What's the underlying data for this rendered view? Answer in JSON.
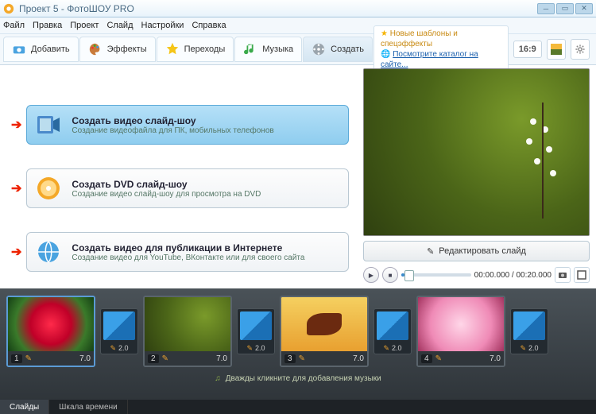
{
  "window": {
    "title": "Проект 5 - ФотоШОУ PRO"
  },
  "menu": {
    "file": "Файл",
    "edit": "Правка",
    "project": "Проект",
    "slide": "Слайд",
    "settings": "Настройки",
    "help": "Справка"
  },
  "tabs": {
    "add": "Добавить",
    "effects": "Эффекты",
    "transitions": "Переходы",
    "music": "Музыка",
    "create": "Создать"
  },
  "promo": {
    "line1": "Новые шаблоны и спецэффекты",
    "line2": "Посмотрите каталог на сайте..."
  },
  "aspect": "16:9",
  "actions": {
    "video": {
      "title": "Создать видео слайд-шоу",
      "subtitle": "Создание видеофайла для ПК, мобильных телефонов"
    },
    "dvd": {
      "title": "Создать DVD слайд-шоу",
      "subtitle": "Создание видео слайд-шоу для просмотра на DVD"
    },
    "web": {
      "title": "Создать видео для публикации в Интернете",
      "subtitle": "Создание видео для YouTube, ВКонтакте или для своего сайта"
    }
  },
  "preview": {
    "edit_label": "Редактировать слайд",
    "time_current": "00:00.000",
    "time_total": "00:20.000"
  },
  "timeline": {
    "slides": [
      {
        "index": "1",
        "duration": "7.0"
      },
      {
        "index": "2",
        "duration": "7.0"
      },
      {
        "index": "3",
        "duration": "7.0"
      },
      {
        "index": "4",
        "duration": "7.0"
      }
    ],
    "transitions": [
      {
        "duration": "2.0"
      },
      {
        "duration": "2.0"
      },
      {
        "duration": "2.0"
      },
      {
        "duration": "2.0"
      }
    ],
    "music_hint": "Дважды кликните для добавления музыки"
  },
  "bottom_tabs": {
    "slides": "Слайды",
    "timeline": "Шкала времени"
  }
}
